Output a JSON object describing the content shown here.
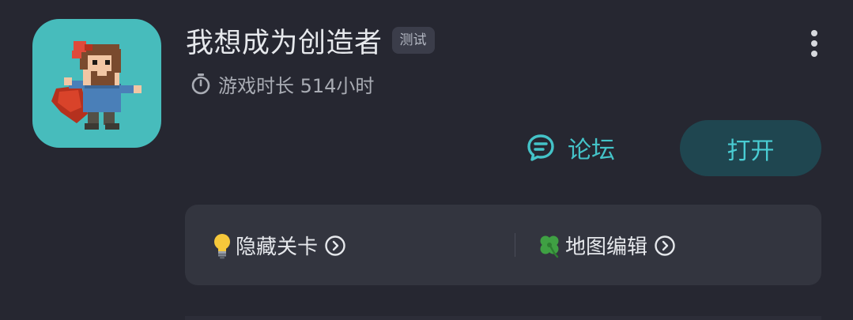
{
  "app": {
    "name": "我想成为创造者",
    "tag": "测试",
    "playtime": "游戏时长 514小时",
    "icon_bg": "#47bcbc"
  },
  "actions": {
    "forum_label": "论坛",
    "open_label": "打开",
    "accent": "#44c3c8"
  },
  "features": [
    {
      "label": "隐藏关卡",
      "icon": "lightbulb-icon"
    },
    {
      "label": "地图编辑",
      "icon": "clover-icon"
    }
  ],
  "icons": {
    "more": "more-vertical-icon",
    "timer": "stopwatch-icon",
    "forum": "chat-bubble-icon",
    "arrow": "circle-chevron-right-icon"
  }
}
